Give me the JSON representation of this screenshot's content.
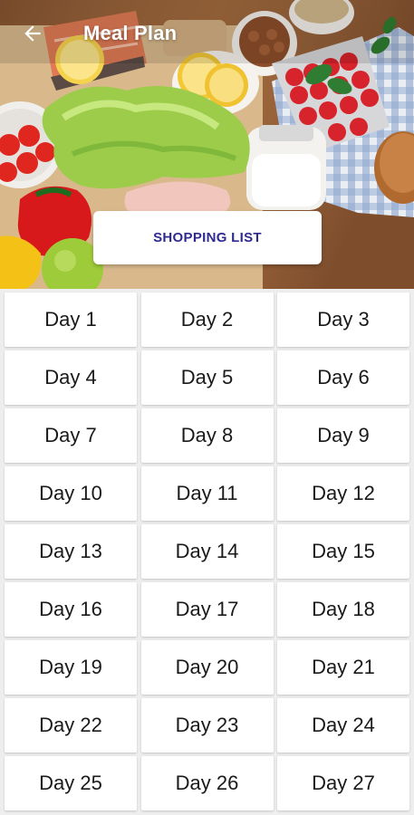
{
  "header": {
    "title": "Meal Plan",
    "back_icon": "arrow-left-icon",
    "background_image": "food-ingredients-photo"
  },
  "shopping_list": {
    "label": "SHOPPING LIST",
    "text_color": "#2e2a8f"
  },
  "days": [
    {
      "label": "Day 1"
    },
    {
      "label": "Day 2"
    },
    {
      "label": "Day 3"
    },
    {
      "label": "Day 4"
    },
    {
      "label": "Day 5"
    },
    {
      "label": "Day 6"
    },
    {
      "label": "Day 7"
    },
    {
      "label": "Day 8"
    },
    {
      "label": "Day 9"
    },
    {
      "label": "Day 10"
    },
    {
      "label": "Day 11"
    },
    {
      "label": "Day 12"
    },
    {
      "label": "Day 13"
    },
    {
      "label": "Day 14"
    },
    {
      "label": "Day 15"
    },
    {
      "label": "Day 16"
    },
    {
      "label": "Day 17"
    },
    {
      "label": "Day 18"
    },
    {
      "label": "Day 19"
    },
    {
      "label": "Day 20"
    },
    {
      "label": "Day 21"
    },
    {
      "label": "Day 22"
    },
    {
      "label": "Day 23"
    },
    {
      "label": "Day 24"
    },
    {
      "label": "Day 25"
    },
    {
      "label": "Day 26"
    },
    {
      "label": "Day 27"
    }
  ]
}
